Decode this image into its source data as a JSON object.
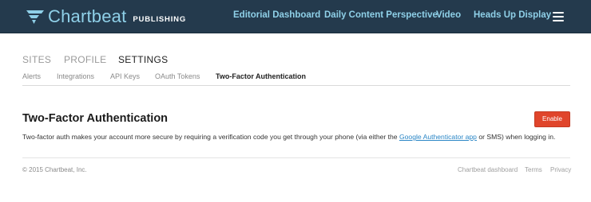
{
  "header": {
    "brand_name": "Chartbeat",
    "brand_subtitle": "PUBLISHING",
    "logo_icon": "chartbeat-logo-icon",
    "nav": [
      "Editorial Dashboard",
      "Daily Content Perspective",
      "Video",
      "Heads Up Display"
    ],
    "menu_icon": "hamburger-menu-icon",
    "bg_color": "#243a4d",
    "link_color": "#8fd0e8"
  },
  "tabs": {
    "primary": [
      "SITES",
      "PROFILE",
      "SETTINGS"
    ],
    "primary_active": "SETTINGS",
    "secondary": [
      "Alerts",
      "Integrations",
      "API Keys",
      "OAuth Tokens",
      "Two-Factor Authentication"
    ],
    "secondary_active": "Two-Factor Authentication"
  },
  "section": {
    "title": "Two-Factor Authentication",
    "enable_label": "Enable",
    "enable_color": "#e0452b",
    "description_before": "Two-factor auth makes your account more secure by requiring a verification code you get through your phone (via either the ",
    "description_link": "Google Authenticator app",
    "description_after": " or SMS) when logging in."
  },
  "footer": {
    "copyright": "© 2015 Chartbeat, Inc.",
    "links": [
      "Chartbeat dashboard",
      "Terms",
      "Privacy"
    ]
  }
}
